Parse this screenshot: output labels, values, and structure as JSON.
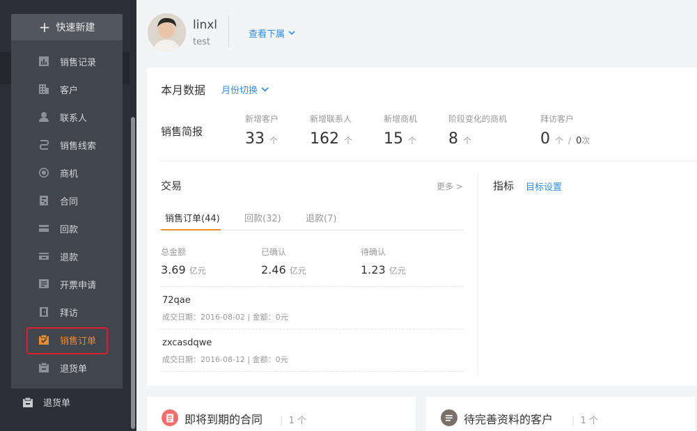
{
  "sidebar": {
    "quick_create_label": "快速新建",
    "items": [
      {
        "label": "销售记录",
        "icon": "bar-chart-icon"
      },
      {
        "label": "客户",
        "icon": "building-icon"
      },
      {
        "label": "联系人",
        "icon": "person-icon"
      },
      {
        "label": "销售线索",
        "icon": "lead-icon"
      },
      {
        "label": "商机",
        "icon": "target-icon"
      },
      {
        "label": "合同",
        "icon": "contract-icon"
      },
      {
        "label": "回款",
        "icon": "card-icon"
      },
      {
        "label": "退款",
        "icon": "refund-icon"
      },
      {
        "label": "开票申请",
        "icon": "invoice-icon"
      },
      {
        "label": "拜访",
        "icon": "visit-icon"
      },
      {
        "label": "销售订单",
        "icon": "order-check-icon"
      },
      {
        "label": "退货单",
        "icon": "return-icon"
      }
    ],
    "active_index": 10,
    "bottom_item_label": "退货单",
    "accent_color": "#f08c2e"
  },
  "user": {
    "name": "linxl",
    "role": "test",
    "subordinate_link": "查看下属"
  },
  "monthly": {
    "title": "本月数据",
    "switch_label": "月份切换",
    "brief_label": "销售简报",
    "stats": [
      {
        "label": "新增客户",
        "value": "33",
        "unit": "个"
      },
      {
        "label": "新增联系人",
        "value": "162",
        "unit": "个"
      },
      {
        "label": "新增商机",
        "value": "15",
        "unit": "个"
      },
      {
        "label": "阶段变化的商机",
        "value": "8",
        "unit": "个"
      }
    ],
    "visit": {
      "label": "拜访客户",
      "value": "0",
      "unit": "个",
      "separator": "/",
      "value2": "0",
      "unit2": "次"
    }
  },
  "trade": {
    "title": "交易",
    "more_label": "更多 >",
    "tabs": [
      {
        "label": "销售订单(44)"
      },
      {
        "label": "回款(32)"
      },
      {
        "label": "退款(7)"
      }
    ],
    "amounts": [
      {
        "label": "总金额",
        "value": "3.69",
        "unit": "亿元"
      },
      {
        "label": "已确认",
        "value": "2.46",
        "unit": "亿元"
      },
      {
        "label": "待确认",
        "value": "1.23",
        "unit": "亿元"
      }
    ],
    "orders": [
      {
        "name": "72qae",
        "meta": "成交日期：2016-08-02 | 金额：0元"
      },
      {
        "name": "zxcasdqwe",
        "meta": "成交日期：2016-08-12 | 金额：0元"
      }
    ]
  },
  "kpi": {
    "title": "指标",
    "settings_link": "目标设置"
  },
  "bottom_cards": [
    {
      "title": "即将到期的合同",
      "count": "1 个",
      "icon": "document-icon",
      "color": "#f26d6d"
    },
    {
      "title": "待完善资料的客户",
      "count": "1 个",
      "icon": "list-icon",
      "color": "#7a6f6a"
    }
  ]
}
